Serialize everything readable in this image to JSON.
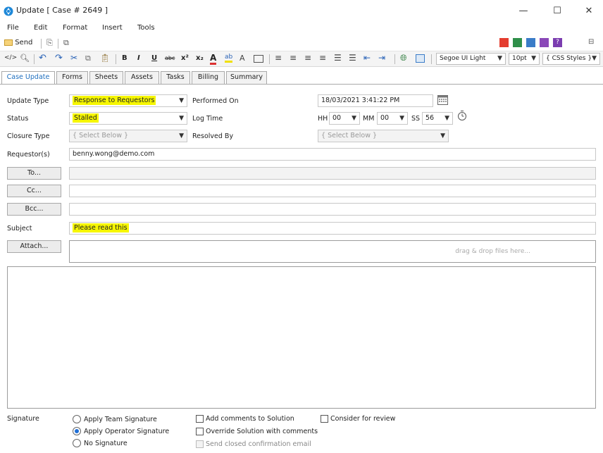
{
  "window": {
    "title": "Update [ Case # 2649 ]",
    "minimize": "—",
    "maximize": "☐",
    "close": "✕"
  },
  "menu": [
    "File",
    "Edit",
    "Format",
    "Insert",
    "Tools"
  ],
  "toolbar1": {
    "send_label": "Send"
  },
  "toolbar2": {
    "font": "Segoe UI Light",
    "size": "10pt",
    "styles": "{ CSS Styles }"
  },
  "tabs": [
    "Case Update",
    "Forms",
    "Sheets",
    "Assets",
    "Tasks",
    "Billing",
    "Summary"
  ],
  "form": {
    "update_type_label": "Update Type",
    "update_type_value": "Response to Requestors",
    "status_label": "Status",
    "status_value": "Stalled",
    "closure_type_label": "Closure Type",
    "closure_type_value": "{ Select Below }",
    "requestors_label": "Requestor(s)",
    "requestors_value": "benny.wong@demo.com",
    "to_button": "To...",
    "cc_button": "Cc...",
    "bcc_button": "Bcc...",
    "subject_label": "Subject",
    "subject_value": "Please read this",
    "attach_button": "Attach...",
    "drop_hint": "drag & drop files here...",
    "performed_on_label": "Performed On",
    "performed_on_value": "18/03/2021 3:41:22 PM",
    "log_time_label": "Log Time",
    "hh_label": "HH",
    "hh_value": "00",
    "mm_label": "MM",
    "mm_value": "00",
    "ss_label": "SS",
    "ss_value": "56",
    "resolved_by_label": "Resolved By",
    "resolved_by_value": "{ Select Below }"
  },
  "signature": {
    "label": "Signature",
    "options": [
      "Apply Team Signature",
      "Apply Operator Signature",
      "No Signature"
    ],
    "selected_index": 1
  },
  "checkboxes": {
    "add_comments": "Add comments to Solution",
    "override": "Override Solution with comments",
    "send_closed": "Send closed confirmation email",
    "consider_review": "Consider for review"
  },
  "colors": {
    "highlight": "#f6f600",
    "accent": "#1f6fbf"
  }
}
